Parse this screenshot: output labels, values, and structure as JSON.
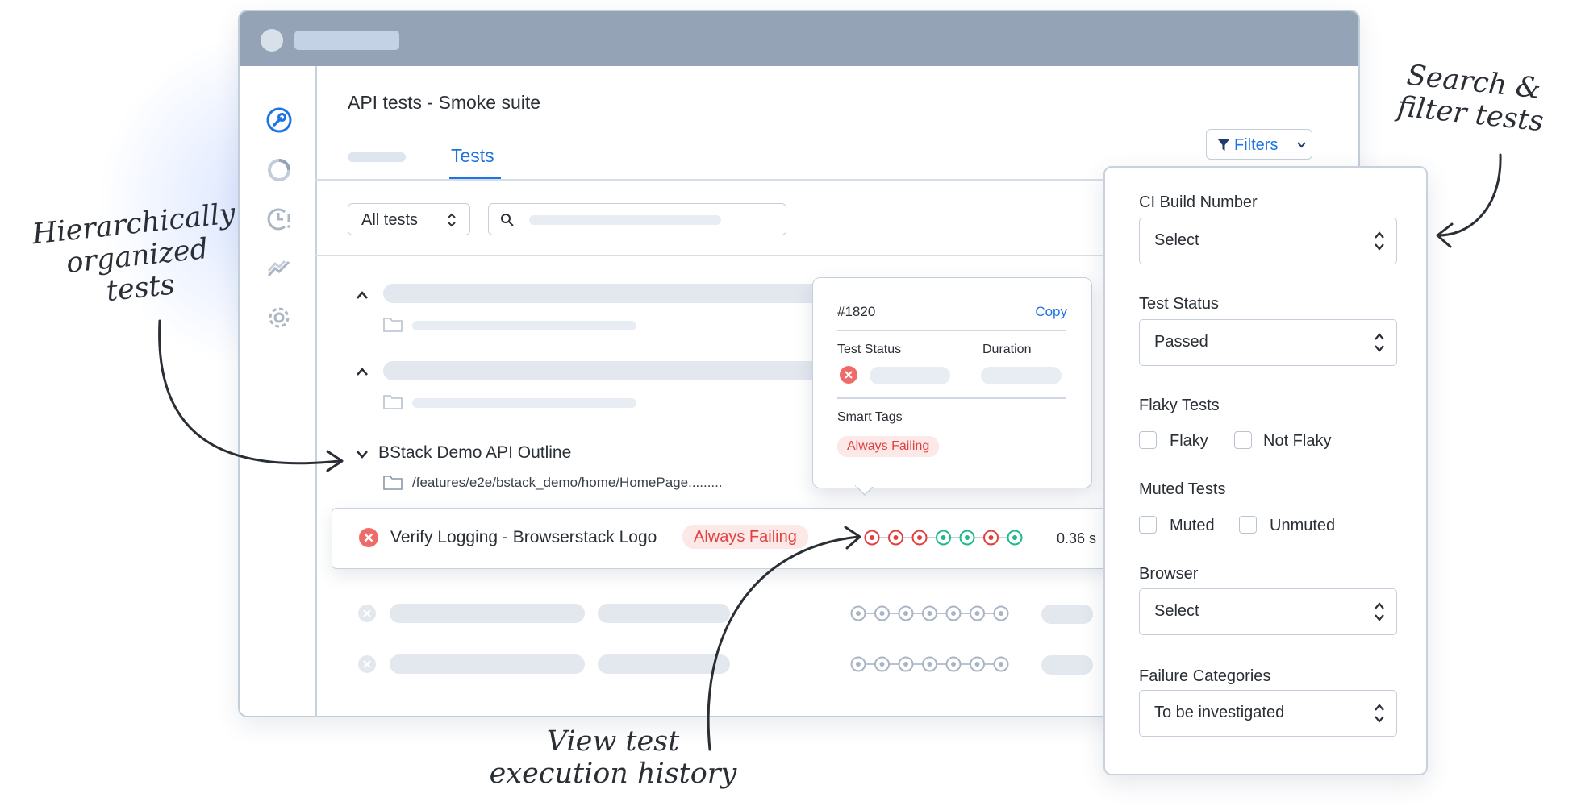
{
  "window": {
    "suite_title": "API tests - Smoke suite",
    "tab_active": "Tests",
    "filters_button": "Filters",
    "test_filter_select": "All tests"
  },
  "tree": {
    "group_title": "BStack Demo API Outline",
    "group_path": "/features/e2e/bstack_demo/home/HomePage.........",
    "active_test": {
      "name": "Verify Logging - Browserstack Logo",
      "badge": "Always Failing",
      "duration": "0.36 s",
      "history": [
        "fail",
        "fail",
        "fail",
        "pass",
        "pass",
        "fail",
        "pass"
      ]
    }
  },
  "popup": {
    "build_id": "#1820",
    "copy_label": "Copy",
    "status_label": "Test Status",
    "duration_label": "Duration",
    "smart_tags_label": "Smart Tags",
    "smart_tag": "Always Failing"
  },
  "filters": {
    "ci_build_label": "CI Build Number",
    "ci_build_value": "Select",
    "test_status_label": "Test Status",
    "test_status_value": "Passed",
    "flaky_label": "Flaky Tests",
    "flaky_opt": "Flaky",
    "not_flaky_opt": "Not Flaky",
    "muted_label": "Muted Tests",
    "muted_opt": "Muted",
    "unmuted_opt": "Unmuted",
    "browser_label": "Browser",
    "browser_value": "Select",
    "failure_label": "Failure Categories",
    "failure_value": "To be investigated"
  },
  "annotations": {
    "hierarchy_1": "Hierarchically",
    "hierarchy_2": "organized",
    "hierarchy_3": "tests",
    "search_1": "Search &",
    "search_2": "filter tests",
    "history_1": "View test",
    "history_2": "execution history"
  },
  "colors": {
    "accent": "#1f74e3",
    "fail": "#e0413f",
    "pass": "#1fb98a",
    "ghost": "#e3e8ef"
  }
}
